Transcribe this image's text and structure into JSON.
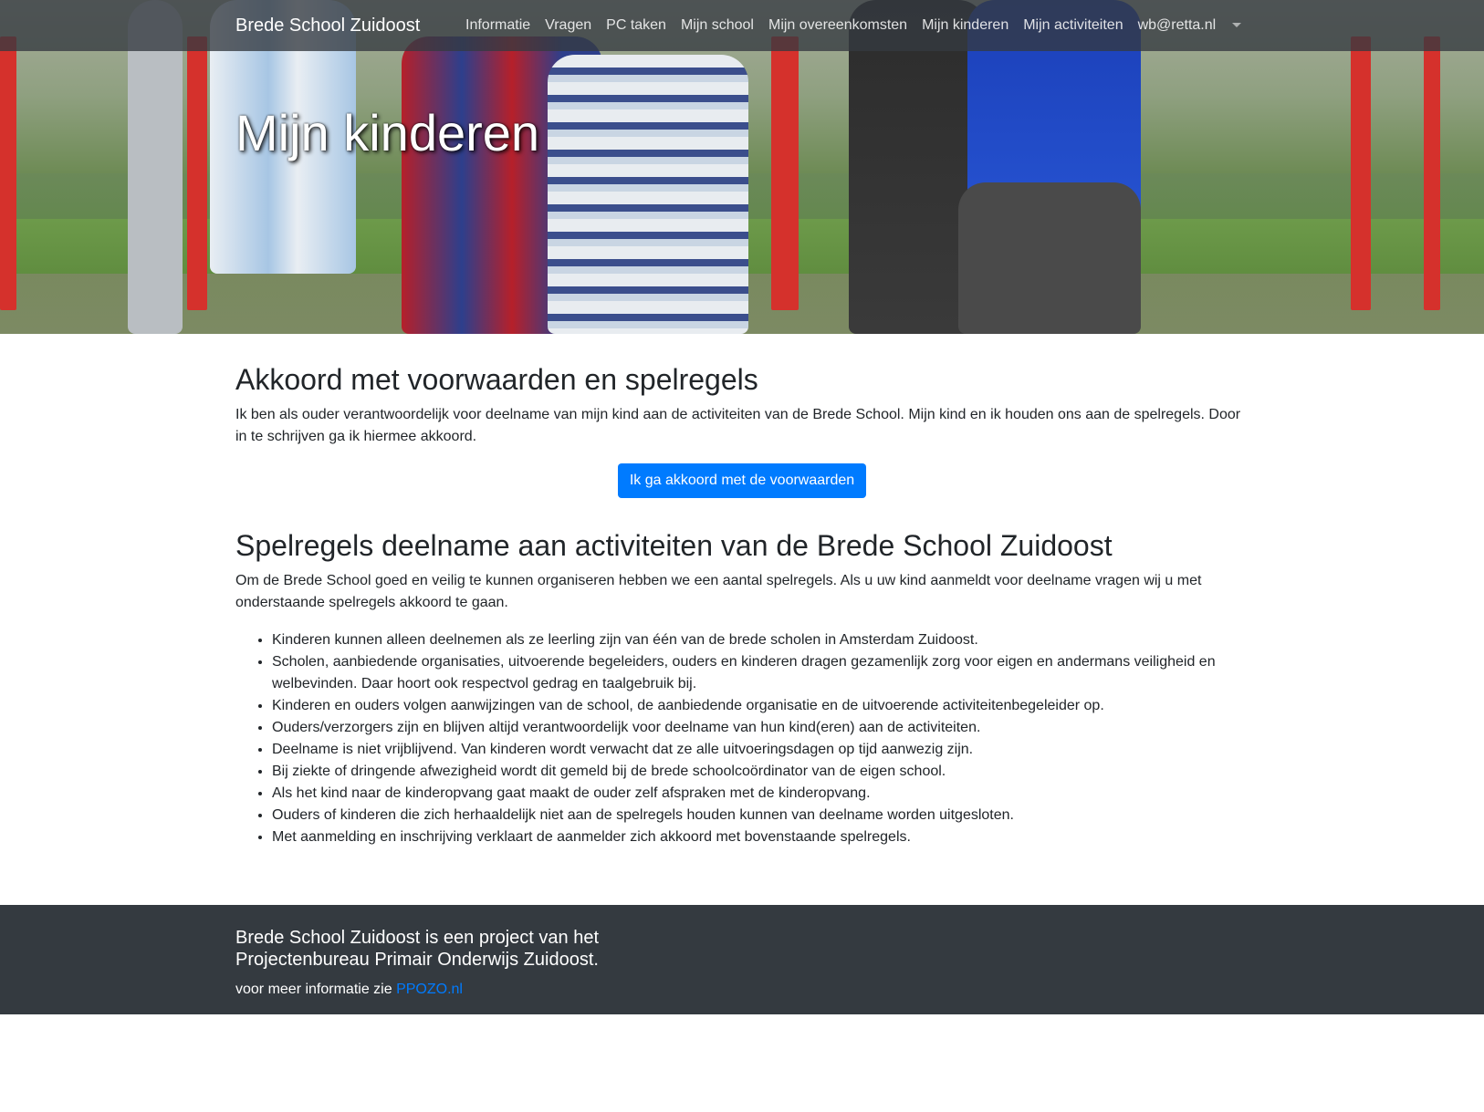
{
  "navbar": {
    "brand": "Brede School Zuidoost",
    "items": [
      {
        "label": "Informatie"
      },
      {
        "label": "Vragen"
      },
      {
        "label": "PC taken"
      },
      {
        "label": "Mijn school"
      },
      {
        "label": "Mijn overeenkomsten"
      },
      {
        "label": "Mijn kinderen"
      },
      {
        "label": "Mijn activiteiten"
      },
      {
        "label": "wb@retta.nl"
      }
    ]
  },
  "hero": {
    "title": "Mijn kinderen"
  },
  "agreement": {
    "heading": "Akkoord met voorwaarden en spelregels",
    "text": "Ik ben als ouder verantwoordelijk voor deelname van mijn kind aan de activiteiten van de Brede School. Mijn kind en ik houden ons aan de spelregels. Door in te schrijven ga ik hiermee akkoord.",
    "button_label": "Ik ga akkoord met de voorwaarden"
  },
  "rules": {
    "heading": "Spelregels deelname aan activiteiten van de Brede School Zuidoost",
    "intro": "Om de Brede School goed en veilig te kunnen organiseren hebben we een aantal spelregels. Als u uw kind aanmeldt voor deelname vragen wij u met onderstaande spelregels akkoord te gaan.",
    "items": [
      "Kinderen kunnen alleen deelnemen als ze leerling zijn van één van de brede scholen in Amsterdam Zuidoost.",
      "Scholen, aanbiedende organisaties, uitvoerende begeleiders, ouders en kinderen dragen gezamenlijk zorg voor eigen en andermans veiligheid en welbevinden. Daar hoort ook respectvol gedrag en taalgebruik bij.",
      "Kinderen en ouders volgen aanwijzingen van de school, de aanbiedende organisatie en de uitvoerende activiteitenbegeleider op.",
      "Ouders/verzorgers zijn en blijven altijd verantwoordelijk voor deelname van hun kind(eren) aan de activiteiten.",
      "Deelname is niet vrijblijvend. Van kinderen wordt verwacht dat ze alle uitvoeringsdagen op tijd aanwezig zijn.",
      "Bij ziekte of dringende afwezigheid wordt dit gemeld bij de brede schoolcoördinator van de eigen school.",
      "Als het kind naar de kinderopvang gaat maakt de ouder zelf afspraken met de kinderopvang.",
      "Ouders of kinderen die zich herhaaldelijk niet aan de spelregels houden kunnen van deelname worden uitgesloten.",
      "Met aanmelding en inschrijving verklaart de aanmelder zich akkoord met bovenstaande spelregels."
    ]
  },
  "footer": {
    "title": "Brede School Zuidoost is een project van het Projectenbureau Primair Onderwijs Zuidoost.",
    "info_prefix": "voor meer informatie zie ",
    "link_label": "PPOZO.nl"
  },
  "colors": {
    "primary": "#007bff",
    "navbar_bg": "#343a40",
    "footer_bg": "#343a40"
  },
  "icons": {
    "dropdown": "caret-down-icon"
  }
}
